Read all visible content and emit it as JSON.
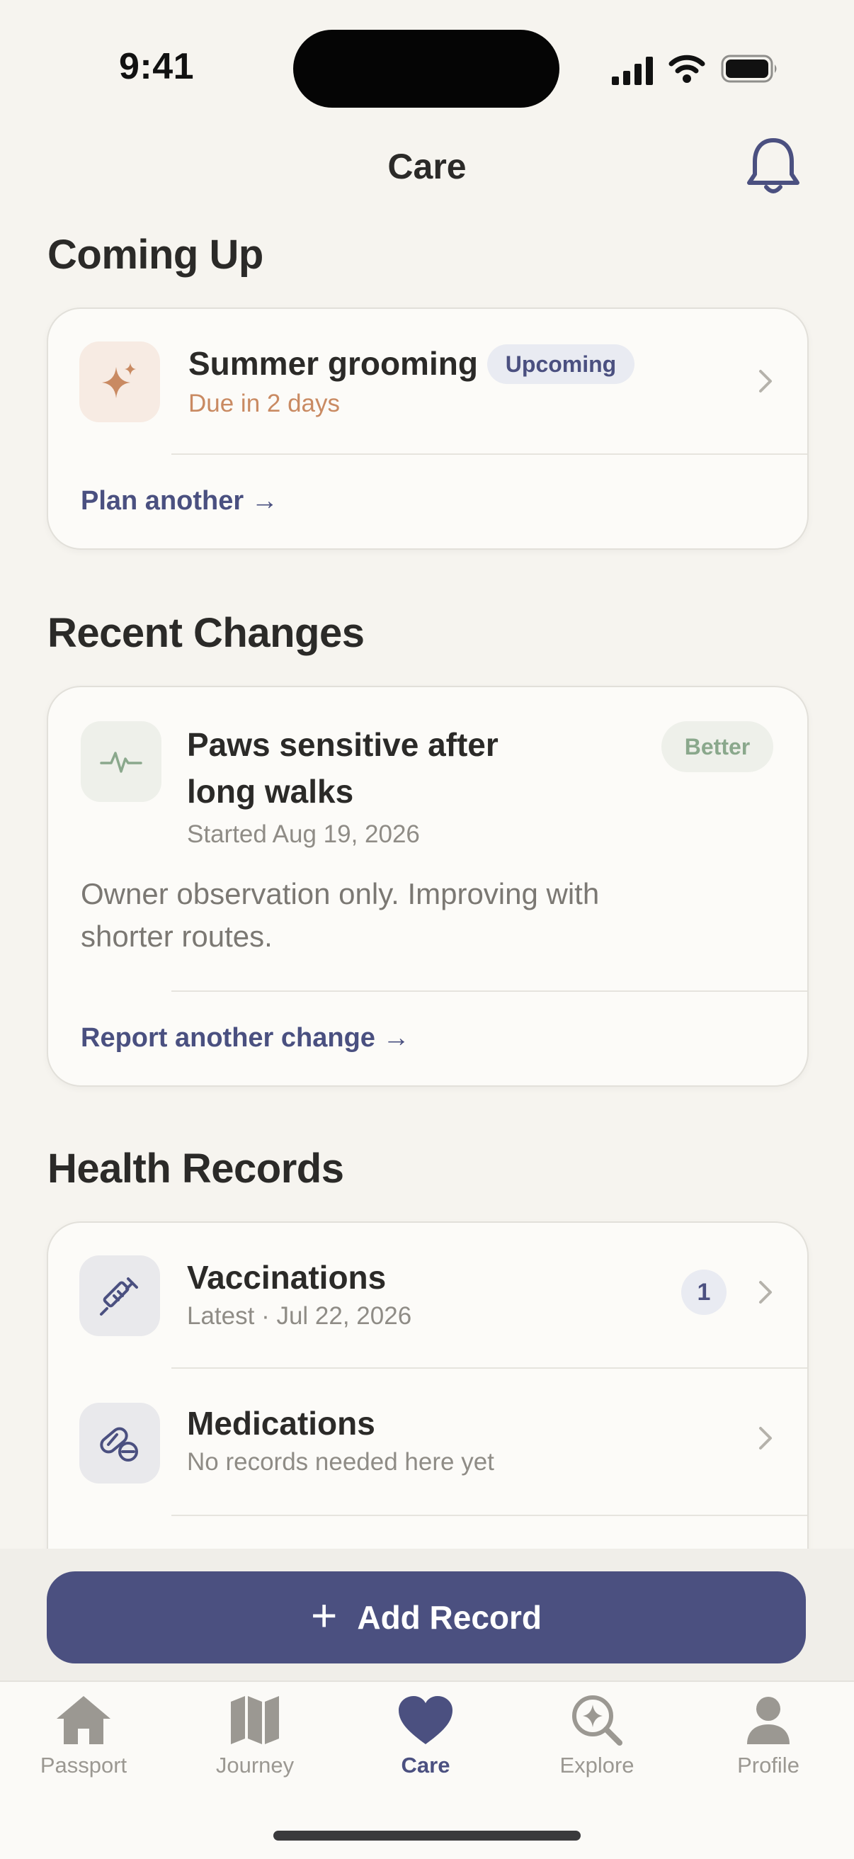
{
  "status_bar": {
    "time": "9:41"
  },
  "nav": {
    "title": "Care"
  },
  "coming_up": {
    "title": "Coming Up",
    "item": {
      "title": "Summer grooming",
      "badge": "Upcoming",
      "subtitle": "Due in 2 days"
    },
    "link": "Plan another →"
  },
  "recent_changes": {
    "title": "Recent Changes",
    "item": {
      "title_line1": "Paws sensitive after",
      "title_line2": "long walks",
      "status": "Better",
      "started": "Started Aug 19, 2026",
      "note_line1": "Owner observation only. Improving with",
      "note_line2": "shorter routes."
    },
    "link": "Report another change →"
  },
  "health_records": {
    "title": "Health Records",
    "items": [
      {
        "title": "Vaccinations",
        "subtitle": "Latest · Jul 22, 2026",
        "count": "1"
      },
      {
        "title": "Medications",
        "subtitle": "No records needed here yet"
      }
    ]
  },
  "add_button": {
    "icon": "+",
    "label": "Add Record"
  },
  "tabs": [
    {
      "label": "Passport",
      "icon": "house-icon"
    },
    {
      "label": "Journey",
      "icon": "map-icon"
    },
    {
      "label": "Care",
      "icon": "heart-icon",
      "active": true
    },
    {
      "label": "Explore",
      "icon": "explore-icon"
    },
    {
      "label": "Profile",
      "icon": "person-icon"
    }
  ],
  "colors": {
    "accent": "#4b5080",
    "warm": "#c98a62",
    "green": "#8aa88c",
    "background": "#f6f4ef"
  }
}
